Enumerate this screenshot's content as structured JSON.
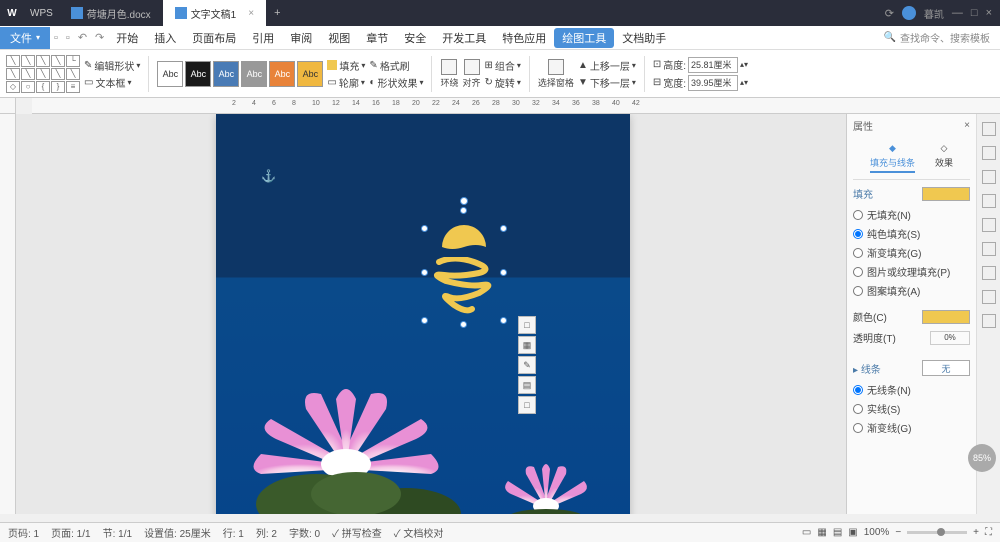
{
  "titlebar": {
    "app": "WPS",
    "tabs": [
      {
        "label": "荷塘月色.docx"
      },
      {
        "label": "文字文稿1"
      }
    ],
    "user": "暮凯"
  },
  "menubar": {
    "file": "文件",
    "items": [
      "开始",
      "插入",
      "页面布局",
      "引用",
      "审阅",
      "视图",
      "章节",
      "安全",
      "开发工具",
      "特色应用"
    ],
    "active": "绘图工具",
    "after": "文档助手",
    "search_placeholder": "查找命令、搜索模板"
  },
  "toolbar": {
    "edit_shape": "编辑形状",
    "text_box": "文本框",
    "swatch_label": "Abc",
    "fill": "填充",
    "outline": "轮廓",
    "shape_fx": "形状效果",
    "format": "格式刷",
    "align": "对齐",
    "rotate": "旋转",
    "group": "组合",
    "wrap": "环绕",
    "up_layer": "上移一层",
    "down_layer": "下移一层",
    "sel_pane": "选择窗格",
    "height_label": "高度:",
    "width_label": "宽度:",
    "height_val": "25.81厘米",
    "width_val": "39.95厘米"
  },
  "ruler": {
    "marks": [
      "2",
      "4",
      "6",
      "8",
      "10",
      "12",
      "14",
      "16",
      "18",
      "20",
      "22",
      "24",
      "26",
      "28",
      "30",
      "32",
      "34",
      "36",
      "38",
      "40",
      "42"
    ]
  },
  "float": [
    "□",
    "▦",
    "✎",
    "▤",
    "□"
  ],
  "panel": {
    "title": "属性",
    "tabs": {
      "fill_line": "填充与线条",
      "effect": "效果"
    },
    "fill_section": "填充",
    "fill_options": {
      "none": "无填充(N)",
      "solid": "纯色填充(S)",
      "gradient": "渐变填充(G)",
      "pic": "图片或纹理填充(P)",
      "pattern": "图案填充(A)"
    },
    "color_label": "颜色(C)",
    "trans_label": "透明度(T)",
    "trans_val": "0%",
    "line_section": "线条",
    "line_style": "无",
    "line_options": {
      "none": "无线条(N)",
      "solid": "实线(S)",
      "gradient": "渐变线(G)"
    }
  },
  "statusbar": {
    "page": "页码: 1",
    "pages": "页面: 1/1",
    "sec": "节: 1/1",
    "pos": "设置值: 25厘米",
    "line": "行: 1",
    "col": "列: 2",
    "wc": "字数: 0",
    "check": "拼写检查",
    "doc_check": "文档校对",
    "zoom": "100%"
  },
  "badge": "85%",
  "colors": {
    "accent": "#4a90d9",
    "fill_swatch": "#f0c850"
  }
}
